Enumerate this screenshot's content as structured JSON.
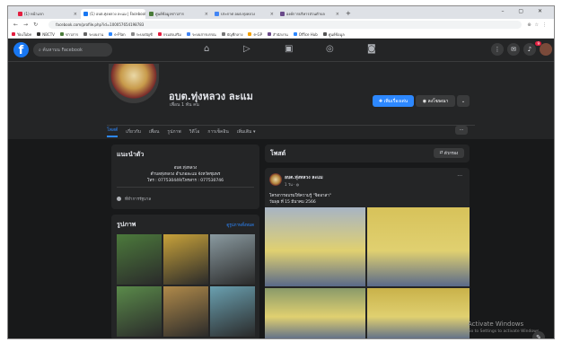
{
  "browser": {
    "tabs": [
      {
        "label": "(1) หน้าแรก",
        "color": "#e41e3f",
        "active": false
      },
      {
        "label": "(1) อบต.ทุ่งหลวง ละแม | Facebook",
        "color": "#1877f2",
        "active": true
      },
      {
        "label": "ศูนย์ข้อมูลข่าวสาร",
        "color": "#4a7b3a",
        "active": false
      },
      {
        "label": "ประกาศ อบต.ทุ่งหลวง",
        "color": "#4285f4",
        "active": false
      },
      {
        "label": "องค์การบริหารส่วนตำบล",
        "color": "#6a4a8a",
        "active": false
      }
    ],
    "new_tab": "+",
    "window_controls": "– ▢ ✕",
    "url": "facebook.com/profile.php?id=100057654198783",
    "bookmarks": [
      {
        "label": "YouTube",
        "color": "#e41e3f"
      },
      {
        "label": "NBCTV",
        "color": "#333333"
      },
      {
        "label": "ข่าวสาร",
        "color": "#4a7b3a"
      },
      {
        "label": "ระบบงาน",
        "color": "#666666"
      },
      {
        "label": "e-Plan",
        "color": "#2d88ff"
      },
      {
        "label": "ระบบบัญชี",
        "color": "#888888"
      },
      {
        "label": "กรมส่งเสริม",
        "color": "#e41e3f"
      },
      {
        "label": "ระบบสารบรรณ",
        "color": "#4285f4"
      },
      {
        "label": "บัญชีกลาง",
        "color": "#777777"
      },
      {
        "label": "e-GP",
        "color": "#f4a100"
      },
      {
        "label": "สำนักงาน",
        "color": "#6a4a8a"
      },
      {
        "label": "Office Hub",
        "color": "#2d88ff"
      },
      {
        "label": "ศูนย์ข้อมูล",
        "color": "#555555"
      }
    ]
  },
  "fb": {
    "logo": "f",
    "search_placeholder": "ค้นหาบน Facebook",
    "notif_count": "9",
    "colors": {
      "accent": "#2d88ff",
      "bg": "#18191a",
      "card": "#242526"
    }
  },
  "page": {
    "name": "อบต.ทุ่งหลวง ละแม",
    "likes": "เพื่อน 1 พัน คน",
    "add_button": "เพิ่มเรื่องเด่น",
    "ads_button": "ลงโฆษณา",
    "more_button": "⌄",
    "tabs": [
      "โพสต์",
      "เกี่ยวกับ",
      "เพื่อน",
      "รูปภาพ",
      "วิดีโอ",
      "การเช็คอิน",
      "เพิ่มเติม ▾"
    ],
    "tabs_more": "···"
  },
  "intro": {
    "heading": "แนะนำตัว",
    "line1": "อบต.ทุ่งหลวง",
    "line2": "ตำบลทุ่งหลวง อำเภอละแม จังหวัดชุมพร",
    "line3": "โทร : 077530449/โทรสาร : 077530746",
    "category": "ที่ทำการรัฐบาล"
  },
  "photos": {
    "heading": "รูปภาพ",
    "see_all": "ดูรูปภาพทั้งหมด",
    "tiles": [
      "#4c7a3c",
      "#c8a23a",
      "#8a9aa0",
      "#5a8a4a",
      "#b08a4a",
      "#6aa0b0"
    ]
  },
  "posts": {
    "heading": "โพสต์",
    "filters": "ตัวกรอง",
    "author": "อบต.ทุ่งหลวง ละแม",
    "time": "1 วัน",
    "text1": "โครงการอบรมให้ความรู้ \"จิตอาสา\"",
    "text2": "วันพุธ ที่ 15 มีนาคม 2566",
    "images": [
      "#a7b4c4",
      "#d7c25a",
      "#8a9a6a",
      "#c9b24a"
    ]
  },
  "watermark": {
    "line1": "Activate Windows",
    "line2": "Go to Settings to activate Windows."
  }
}
